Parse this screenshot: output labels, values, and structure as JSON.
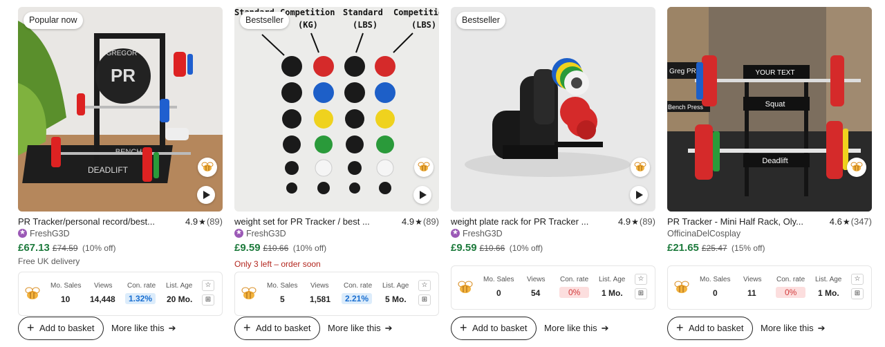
{
  "products": [
    {
      "badge": "Popular now",
      "title": "PR Tracker/personal record/best...",
      "rating": "4.9",
      "reviews": "(89)",
      "seller": "FreshG3D",
      "star_seller": true,
      "price": "£67.13",
      "old_price": "£74.59",
      "discount": "(10% off)",
      "sub_line": "Free UK delivery",
      "sub_alert": false,
      "image_text": [
        "GREGOR",
        "PR",
        "BENCH",
        "DEADLIFT"
      ],
      "stats": {
        "sales_label": "Mo. Sales",
        "sales": "10",
        "views_label": "Views",
        "views": "14,448",
        "conv_label": "Con. rate",
        "conv": "1.32%",
        "age_label": "List. Age",
        "age": "20 Mo."
      },
      "basket_label": "Add to basket",
      "more_label": "More like this"
    },
    {
      "badge": "Bestseller",
      "title": "weight set for PR Tracker / best ...",
      "rating": "4.9",
      "reviews": "(89)",
      "seller": "FreshG3D",
      "star_seller": true,
      "price": "£9.59",
      "old_price": "£10.66",
      "discount": "(10% off)",
      "sub_line": "Only 3 left – order soon",
      "sub_alert": true,
      "image_text": [
        "Standard",
        "Competition",
        "Standard",
        "Competition",
        "(KG)",
        "(LBS)",
        "(LBS)"
      ],
      "stats": {
        "sales_label": "Mo. Sales",
        "sales": "5",
        "views_label": "Views",
        "views": "1,581",
        "conv_label": "Con. rate",
        "conv": "2.21%",
        "age_label": "List. Age",
        "age": "5 Mo."
      },
      "basket_label": "Add to basket",
      "more_label": "More like this"
    },
    {
      "badge": "Bestseller",
      "title": "weight plate rack for PR Tracker ...",
      "rating": "4.9",
      "reviews": "(89)",
      "seller": "FreshG3D",
      "star_seller": true,
      "price": "£9.59",
      "old_price": "£10.66",
      "discount": "(10% off)",
      "sub_line": "",
      "sub_alert": false,
      "image_text": [],
      "stats": {
        "sales_label": "Mo. Sales",
        "sales": "0",
        "views_label": "Views",
        "views": "54",
        "conv_label": "Con. rate",
        "conv": "0%",
        "age_label": "List. Age",
        "age": "1 Mo."
      },
      "basket_label": "Add to basket",
      "more_label": "More like this"
    },
    {
      "badge": "",
      "title": "PR Tracker - Mini Half Rack, Oly...",
      "rating": "4.6",
      "reviews": "(347)",
      "seller": "OfficinaDelCosplay",
      "star_seller": false,
      "price": "£21.65",
      "old_price": "£25.47",
      "discount": "(15% off)",
      "sub_line": "",
      "sub_alert": false,
      "image_text": [
        "Greg PR",
        "YOUR TEXT",
        "Bench Press",
        "Squat",
        "Deadlift"
      ],
      "stats": {
        "sales_label": "Mo. Sales",
        "sales": "0",
        "views_label": "Views",
        "views": "11",
        "conv_label": "Con. rate",
        "conv": "0%",
        "age_label": "List. Age",
        "age": "1 Mo."
      },
      "basket_label": "Add to basket",
      "more_label": "More like this"
    }
  ]
}
